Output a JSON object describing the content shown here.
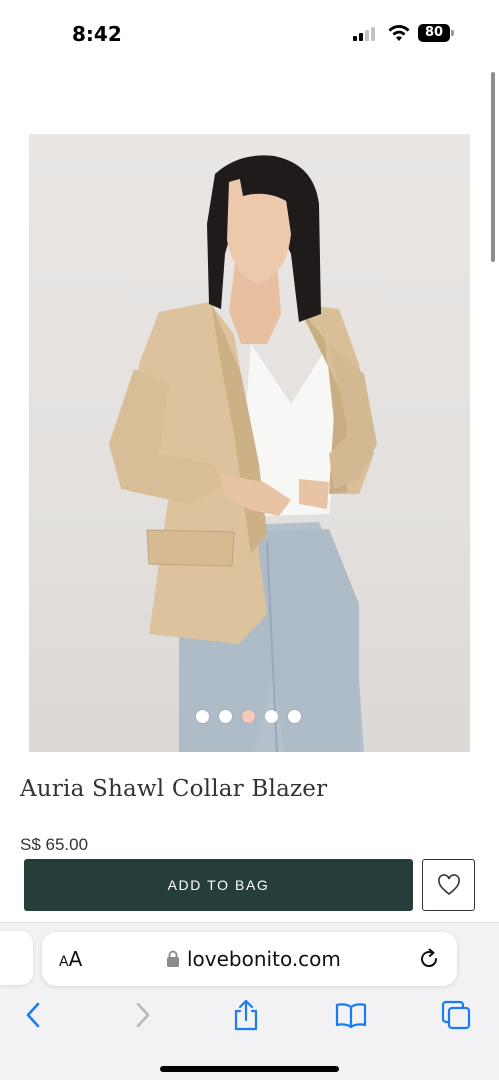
{
  "status_bar": {
    "time": "8:42",
    "battery": "80"
  },
  "product": {
    "title": "Auria Shawl Collar Blazer",
    "price": "S$ 65.00",
    "image_count": 5,
    "active_image_index": 3
  },
  "actions": {
    "add_to_bag_label": "ADD TO BAG"
  },
  "browser": {
    "aa_label_small": "A",
    "aa_label_large": "A",
    "url": "lovebonito.com"
  },
  "colors": {
    "primary_button": "#253d3b",
    "active_dot": "#f5c9b9",
    "safari_blue": "#1a7cf5"
  },
  "icons": {
    "wishlist": "heart-icon",
    "lock": "lock-icon",
    "reload": "reload-icon",
    "back": "chevron-left-icon",
    "forward": "chevron-right-icon",
    "share": "share-icon",
    "bookmarks": "book-icon",
    "tabs": "tabs-icon"
  }
}
